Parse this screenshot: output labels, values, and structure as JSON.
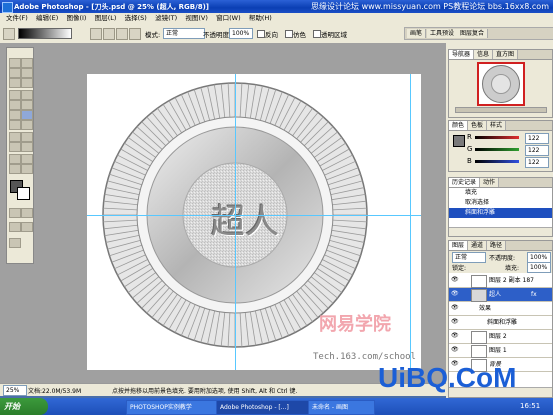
{
  "window": {
    "title": "Adobe Photoshop - [刀头.psd @ 25% (超人, RGB/8)]",
    "watermark_top": "思缘设计论坛 www.missyuan.com PS教程论坛 bbs.16xx8.com"
  },
  "menu": [
    "文件(F)",
    "编辑(E)",
    "图像(I)",
    "图层(L)",
    "选择(S)",
    "滤镜(T)",
    "视图(V)",
    "窗口(W)",
    "帮助(H)"
  ],
  "options": {
    "mode_label": "模式:",
    "mode_value": "正常",
    "opacity_label": "不透明度:",
    "opacity_value": "100%",
    "reverse_label": "反向",
    "dither_label": "仿色",
    "transparency_label": "透明区域"
  },
  "palette_well": [
    "画笔",
    "工具预设",
    "图层复合"
  ],
  "canvas": {
    "text": "超人",
    "watermark_site": "网易学院",
    "watermark_url": "Tech.163.com/school"
  },
  "navigator": {
    "tabs": [
      "导航器",
      "信息",
      "直方图"
    ]
  },
  "color_panel": {
    "tabs": [
      "颜色",
      "色板",
      "样式"
    ],
    "channels": [
      {
        "name": "R",
        "value": "122",
        "color": "#e03030"
      },
      {
        "name": "G",
        "value": "122",
        "color": "#30a030"
      },
      {
        "name": "B",
        "value": "122",
        "color": "#3050e0"
      }
    ]
  },
  "history": {
    "tabs": [
      "历史记录",
      "动作"
    ],
    "items": [
      "填充",
      "取消选择",
      "斜面和浮雕"
    ],
    "selected_index": 2
  },
  "layers": {
    "tabs": [
      "图层",
      "通道",
      "路径"
    ],
    "blend_mode": "正常",
    "opacity_label": "不透明度:",
    "opacity_value": "100%",
    "lock_label": "锁定:",
    "fill_label": "填充:",
    "fill_value": "100%",
    "rows": [
      {
        "name": "图层 2 副本 187",
        "selected": false
      },
      {
        "name": "超人",
        "selected": true,
        "fx": "fx"
      },
      {
        "name": "效果",
        "selected": false,
        "sub": true
      },
      {
        "name": "斜面和浮雕",
        "selected": false,
        "sub2": true
      },
      {
        "name": "图层 2",
        "selected": false
      },
      {
        "name": "图层 1",
        "selected": false
      },
      {
        "name": "背景",
        "selected": false
      }
    ]
  },
  "status": {
    "zoom": "25%",
    "doc": "文档:22.0M/53.9M",
    "hint": "点按并拖移以用前景色填充. 要用附加选项, 使用 Shift, Alt 和 Ctrl 键."
  },
  "taskbar": {
    "start": "开始",
    "items": [
      "PHOTOSHOP实例教学",
      "Adobe Photoshop - [...]",
      "未命名 - 画图"
    ],
    "clock": "16:51"
  },
  "uibq_watermark": "UiBQ.CoM"
}
